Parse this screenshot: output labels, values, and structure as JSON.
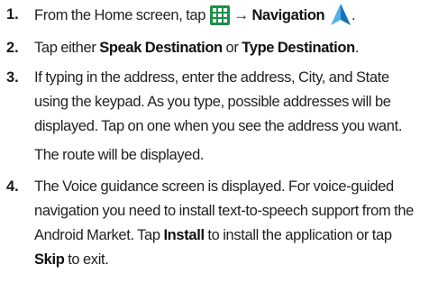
{
  "steps": [
    {
      "number": "1.",
      "text_before": "From the Home screen, tap",
      "arrow": "→",
      "bold_1": "Navigation",
      "text_after": "."
    },
    {
      "number": "2.",
      "text_1": "Tap either",
      "bold_1": "Speak Destination",
      "text_2": "or",
      "bold_2": "Type Destination",
      "text_3": "."
    },
    {
      "number": "3.",
      "text_1": "If typing in the address, enter the address, City, and State using the keypad. As you type, possible addresses will be displayed. Tap on one when you see the address you want.",
      "text_2": "The route will be displayed."
    },
    {
      "number": "4.",
      "text_1": "The Voice guidance screen is displayed. For voice-guided navigation you need to install text-to-speech support from the Android Market. Tap",
      "bold_1": "Install",
      "text_2": "to install the application or tap",
      "bold_2": "Skip",
      "text_3": "to exit."
    }
  ],
  "icons": {
    "grid": "apps-grid-icon",
    "navigation": "navigation-arrow-icon"
  },
  "colors": {
    "text": "#222222",
    "grid_icon": "#1f8f48",
    "nav_icon": "#2f9bd8"
  }
}
